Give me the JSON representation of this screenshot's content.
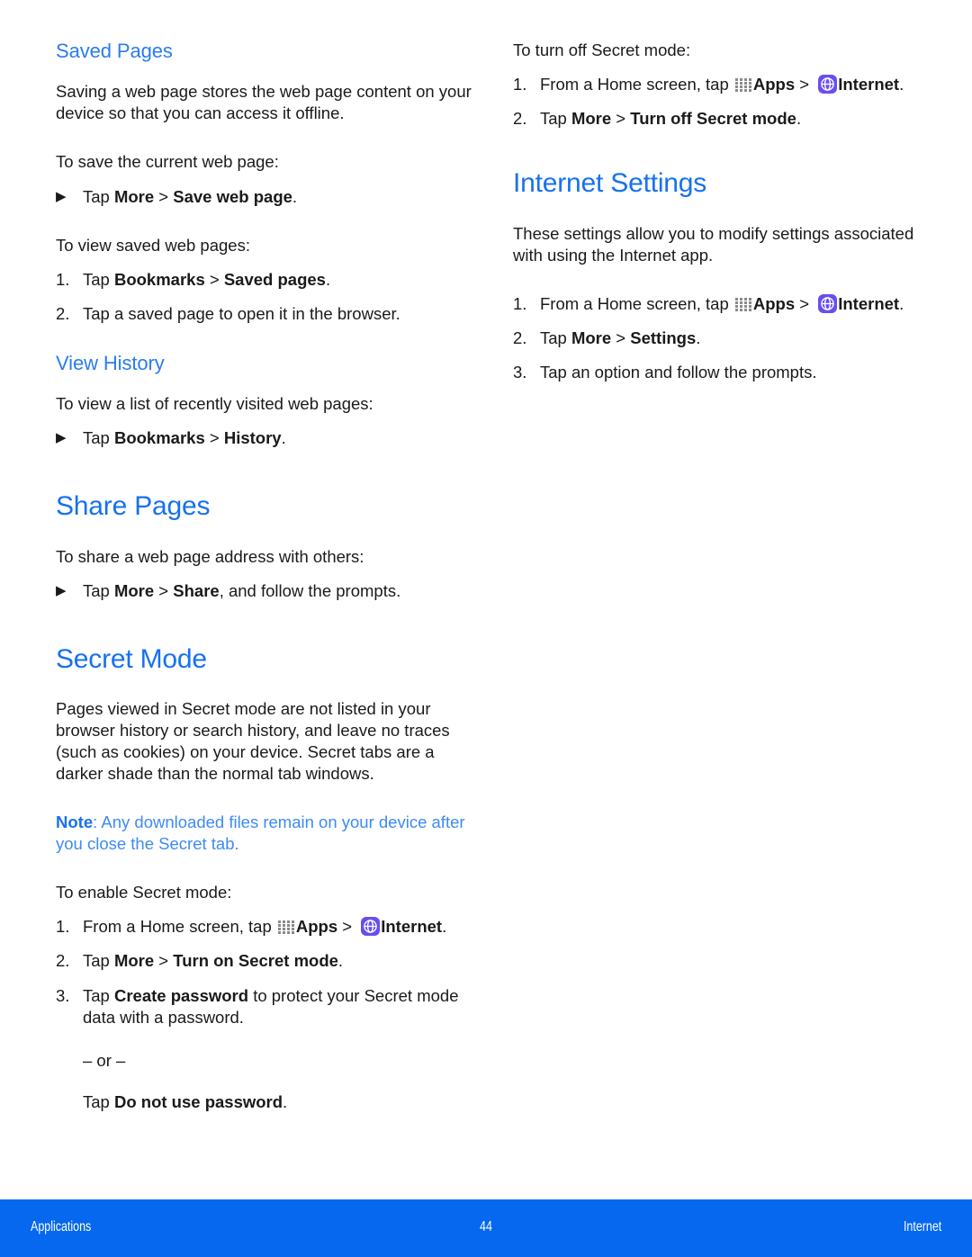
{
  "document": {
    "page_number": "44",
    "footer_left": "Applications",
    "footer_right": "Internet",
    "accent_blue": "#1771ef",
    "footer_blue": "#0568ef",
    "internet_icon_purple": "#6a4df0"
  },
  "icons": {
    "apps_label": "Apps",
    "internet_label": "Internet",
    "separator": ">",
    "arrow_bullet": "▶"
  },
  "left_column": {
    "saved_pages": {
      "title": "Saved Pages",
      "intro": "Saving a web page stores the web page content on your device so that you can access it offline.",
      "lead_save": "To save the current web page:",
      "step_save_marker": "▶",
      "step_save_pre": "Tap ",
      "step_save_bold1": "More",
      "step_save_sep": " > ",
      "step_save_bold2": "Save web page",
      "step_save_post": ".",
      "lead_view": "To view saved web pages:",
      "step1_marker": "1.",
      "step1_pre": "Tap ",
      "step1_bold1": "Bookmarks",
      "step1_sep": " > ",
      "step1_bold2": "Saved pages",
      "step1_post": ".",
      "step2_marker": "2.",
      "step2_text": "Tap a saved page to open it in the browser."
    },
    "view_history": {
      "title": "View History",
      "lead": "To view a list of recently visited web pages:",
      "step_marker": "▶",
      "step_pre": "Tap ",
      "step_bold1": "Bookmarks",
      "step_sep": " > ",
      "step_bold2": "History",
      "step_post": "."
    },
    "share_pages": {
      "title": "Share Pages",
      "lead": "To share a web page address with others:",
      "step_marker": "▶",
      "step_pre": "Tap ",
      "step_bold1": "More",
      "step_sep": " > ",
      "step_bold2": "Share",
      "step_post": ", and follow the prompts."
    },
    "secret_mode": {
      "title": "Secret Mode",
      "intro": "Pages viewed in Secret mode are not listed in your browser history or search history, and leave no traces (such as cookies) on your device. Secret tabs are a darker shade than the normal tab windows.",
      "note_label": "Note",
      "note_body": ": Any downloaded files remain on your device after you close the Secret tab.",
      "lead_enable": "To enable Secret mode:",
      "step1_marker": "1.",
      "step1_pre": "From a Home screen, tap ",
      "step1_apps": "Apps",
      "step1_sep": " > ",
      "step1_internet": "Internet",
      "step1_post": ".",
      "step2_marker": "2.",
      "step2_pre": "Tap ",
      "step2_bold1": "More",
      "step2_sep": " > ",
      "step2_bold2": "Turn on Secret mode",
      "step2_post": ".",
      "step3_marker": "3.",
      "step3_pre": "Tap ",
      "step3_bold": "Create password",
      "step3_post": " to protect your Secret mode data with a password.",
      "or_text": "– or –",
      "step3_alt_pre": "Tap ",
      "step3_alt_bold": "Do not use password",
      "step3_alt_post": "."
    }
  },
  "right_column": {
    "turn_off_secret": {
      "lead": "To turn off Secret mode:",
      "step1_marker": "1.",
      "step1_pre": "From a Home screen, tap ",
      "step1_apps": "Apps",
      "step1_sep": " > ",
      "step1_internet": "Internet",
      "step1_post": ".",
      "step2_marker": "2.",
      "step2_pre": "Tap ",
      "step2_bold1": "More",
      "step2_sep": " > ",
      "step2_bold2": "Turn off Secret mode",
      "step2_post": "."
    },
    "internet_settings": {
      "title": "Internet Settings",
      "intro": "These settings allow you to modify settings associated with using the Internet app.",
      "step1_marker": "1.",
      "step1_pre": "From a Home screen, tap ",
      "step1_apps": "Apps",
      "step1_sep": " > ",
      "step1_internet": "Internet",
      "step1_post": ".",
      "step2_marker": "2.",
      "step2_pre": "Tap ",
      "step2_bold1": "More",
      "step2_sep": " > ",
      "step2_bold2": "Settings",
      "step2_post": ".",
      "step3_marker": "3.",
      "step3_text": "Tap an option and follow the prompts."
    }
  }
}
